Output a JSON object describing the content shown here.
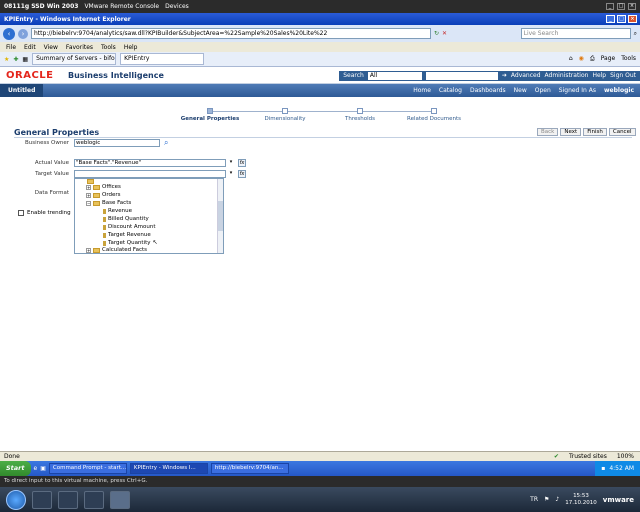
{
  "vmware": {
    "title": "08111g SSD Win 2003",
    "menu1": "VMware Remote Console",
    "menu2": "Devices",
    "hint": "To direct input to this virtual machine, press Ctrl+G."
  },
  "browser": {
    "title": "KPIEntry - Windows Internet Explorer",
    "address": "http://biebelrv:9704/analytics/saw.dll?KPIBuilder&SubjectArea=%22Sample%20Sales%20Lite%22",
    "search_placeholder": "Live Search",
    "menu": [
      "File",
      "Edit",
      "View",
      "Favorites",
      "Tools",
      "Help"
    ],
    "tabs": [
      "Summary of Servers - bifoun...",
      "KPIEntry"
    ],
    "tools": [
      "Page",
      "Tools"
    ],
    "status_left": "Done",
    "status_zone": "Trusted sites",
    "zoom": "100%"
  },
  "obi": {
    "logo": "ORACLE",
    "product": "Business Intelligence",
    "search_label": "Search",
    "search_scope": "All",
    "header_links": [
      "Advanced",
      "Administration",
      "Help",
      "Sign Out"
    ],
    "tab_label": "Untitled",
    "nav_links": [
      "Home",
      "Catalog",
      "Dashboards",
      "New",
      "Open",
      "Signed In As",
      "weblogic"
    ]
  },
  "train": {
    "steps": [
      "General Properties",
      "Dimensionality",
      "Thresholds",
      "Related Documents"
    ]
  },
  "form": {
    "title": "General Properties",
    "buttons": [
      "Back",
      "Next",
      "Finish",
      "Cancel"
    ],
    "business_owner_label": "Business Owner",
    "business_owner_value": "weblogic",
    "actual_value_label": "Actual Value",
    "actual_value": "\"Base Facts\".\"Revenue\"",
    "target_value_label": "Target Value",
    "data_format_label": "Data Format",
    "enable_trending_label": "Enable trending"
  },
  "tree": {
    "items": [
      {
        "label": "Offices",
        "level": 1,
        "type": "folder",
        "exp": "+"
      },
      {
        "label": "Orders",
        "level": 1,
        "type": "folder",
        "exp": "+"
      },
      {
        "label": "Base Facts",
        "level": 1,
        "type": "folder",
        "exp": "-"
      },
      {
        "label": "Revenue",
        "level": 2,
        "type": "column"
      },
      {
        "label": "Billed Quantity",
        "level": 2,
        "type": "column"
      },
      {
        "label": "Discount Amount",
        "level": 2,
        "type": "column"
      },
      {
        "label": "Target Revenue",
        "level": 2,
        "type": "column"
      },
      {
        "label": "Target Quantity",
        "level": 2,
        "type": "column"
      },
      {
        "label": "Calculated Facts",
        "level": 1,
        "type": "folder",
        "exp": "+"
      }
    ]
  },
  "guest_taskbar": {
    "start": "Start",
    "tasks": [
      "Command Prompt - start...",
      "KPIEntry - Windows I...",
      "http://biebelrv:9704/an..."
    ],
    "time": "4:52 AM"
  },
  "host_taskbar": {
    "lang": "TR",
    "time": "15:53",
    "date": "17.10.2010",
    "vmware_logo": "vmware"
  }
}
